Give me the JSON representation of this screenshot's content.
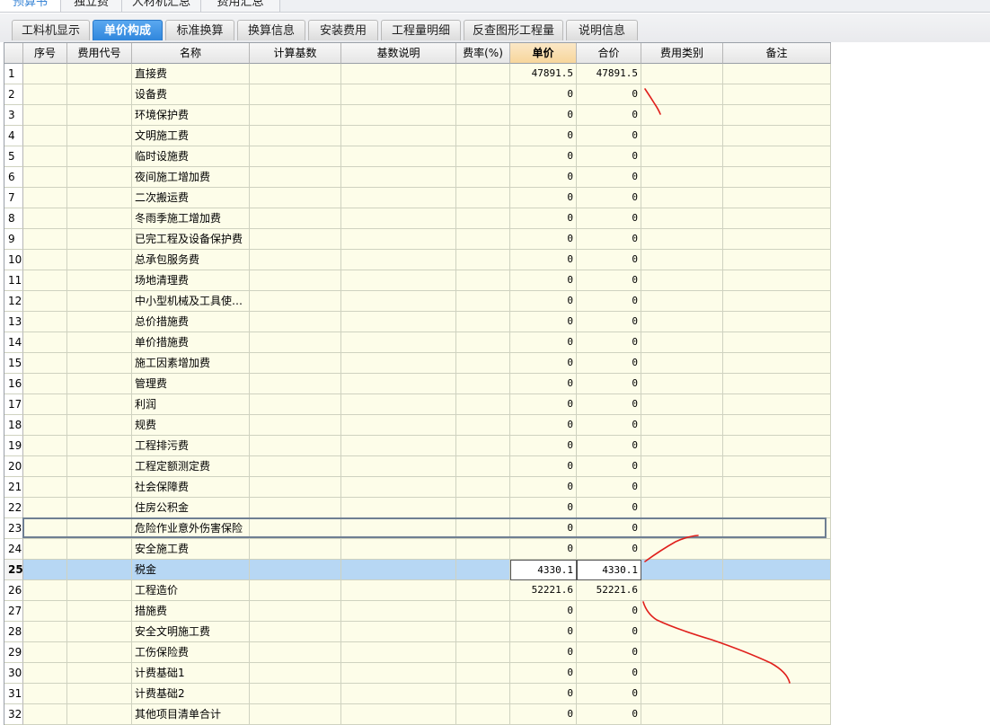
{
  "top_tabs": [
    {
      "label": "预算书",
      "active": true
    },
    {
      "label": "独立费",
      "active": false
    },
    {
      "label": "人材机汇总",
      "active": false
    },
    {
      "label": "费用汇总",
      "active": false
    }
  ],
  "tabs": [
    {
      "label": "工料机显示",
      "active": false
    },
    {
      "label": "单价构成",
      "active": true
    },
    {
      "label": "标准换算",
      "active": false
    },
    {
      "label": "换算信息",
      "active": false
    },
    {
      "label": "安装费用",
      "active": false
    },
    {
      "label": "工程量明细",
      "active": false
    },
    {
      "label": "反查图形工程量",
      "active": false
    },
    {
      "label": "说明信息",
      "active": false
    }
  ],
  "columns": [
    "",
    "序号",
    "费用代号",
    "名称",
    "计算基数",
    "基数说明",
    "费率(%)",
    "单价",
    "合价",
    "费用类别",
    "备注"
  ],
  "selected_column": "单价",
  "selected_row": "25",
  "rows": [
    {
      "n": "1",
      "name": "直接费",
      "price": "47891.5",
      "total": "47891.5"
    },
    {
      "n": "2",
      "name": "设备费",
      "price": "0",
      "total": "0"
    },
    {
      "n": "3",
      "name": "环境保护费",
      "price": "0",
      "total": "0"
    },
    {
      "n": "4",
      "name": "文明施工费",
      "price": "0",
      "total": "0"
    },
    {
      "n": "5",
      "name": "临时设施费",
      "price": "0",
      "total": "0"
    },
    {
      "n": "6",
      "name": "夜间施工增加费",
      "price": "0",
      "total": "0"
    },
    {
      "n": "7",
      "name": "二次搬运费",
      "price": "0",
      "total": "0"
    },
    {
      "n": "8",
      "name": "冬雨季施工增加费",
      "price": "0",
      "total": "0"
    },
    {
      "n": "9",
      "name": "已完工程及设备保护费",
      "price": "0",
      "total": "0"
    },
    {
      "n": "10",
      "name": "总承包服务费",
      "price": "0",
      "total": "0"
    },
    {
      "n": "11",
      "name": "场地清理费",
      "price": "0",
      "total": "0"
    },
    {
      "n": "12",
      "name": "中小型机械及工具使…",
      "price": "0",
      "total": "0"
    },
    {
      "n": "13",
      "name": "总价措施费",
      "price": "0",
      "total": "0"
    },
    {
      "n": "14",
      "name": "单价措施费",
      "price": "0",
      "total": "0"
    },
    {
      "n": "15",
      "name": "施工因素增加费",
      "price": "0",
      "total": "0"
    },
    {
      "n": "16",
      "name": "管理费",
      "price": "0",
      "total": "0"
    },
    {
      "n": "17",
      "name": "利润",
      "price": "0",
      "total": "0"
    },
    {
      "n": "18",
      "name": "规费",
      "price": "0",
      "total": "0"
    },
    {
      "n": "19",
      "name": "工程排污费",
      "price": "0",
      "total": "0"
    },
    {
      "n": "20",
      "name": "工程定额测定费",
      "price": "0",
      "total": "0"
    },
    {
      "n": "21",
      "name": "社会保障费",
      "price": "0",
      "total": "0"
    },
    {
      "n": "22",
      "name": "住房公积金",
      "price": "0",
      "total": "0"
    },
    {
      "n": "23",
      "name": "危险作业意外伤害保险",
      "price": "0",
      "total": "0"
    },
    {
      "n": "24",
      "name": "安全施工费",
      "price": "0",
      "total": "0"
    },
    {
      "n": "25",
      "name": "税金",
      "price": "4330.1",
      "total": "4330.1"
    },
    {
      "n": "26",
      "name": "工程造价",
      "price": "52221.6",
      "total": "52221.6"
    },
    {
      "n": "27",
      "name": "措施费",
      "price": "0",
      "total": "0"
    },
    {
      "n": "28",
      "name": "安全文明施工费",
      "price": "0",
      "total": "0"
    },
    {
      "n": "29",
      "name": "工伤保险费",
      "price": "0",
      "total": "0"
    },
    {
      "n": "30",
      "name": "计费基础1",
      "price": "0",
      "total": "0"
    },
    {
      "n": "31",
      "name": "计费基础2",
      "price": "0",
      "total": "0"
    },
    {
      "n": "32",
      "name": "其他项目清单合计",
      "price": "0",
      "total": "0"
    }
  ],
  "colors": {
    "accent": "#2f86dc",
    "row_bg": "#fdfde9",
    "selected_row_bg": "#b7d7f4",
    "annotation": "#e0201c"
  }
}
